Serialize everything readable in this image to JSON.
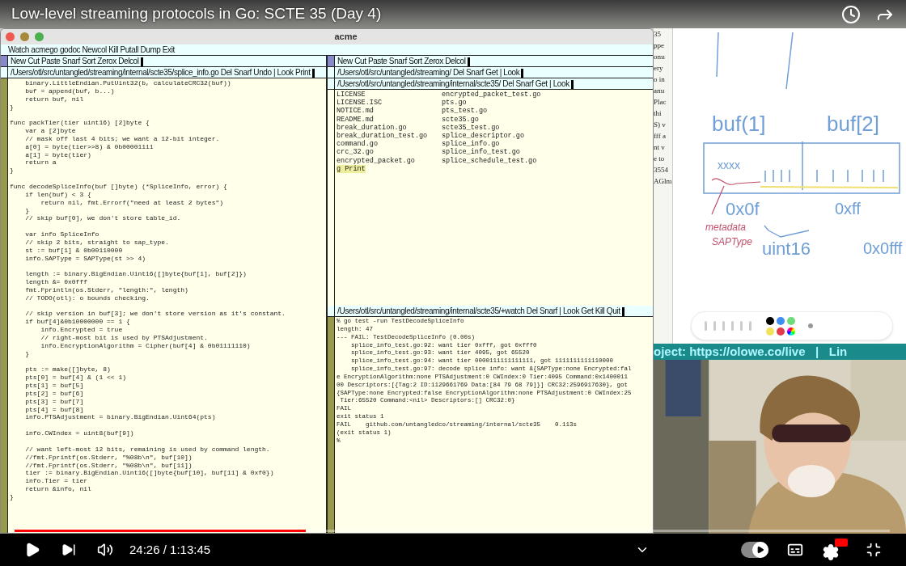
{
  "video": {
    "title": "Low-level streaming protocols in Go: SCTE 35 (Day 4)",
    "progress": {
      "level": 0.333
    },
    "time": "24:26 / 1:13:45",
    "autoplay": {
      "on": true
    }
  },
  "acme": {
    "title": "acme",
    "main_tag": "Watch acmego godoc Newcol Kill Putall Dump Exit",
    "columns": [
      {
        "tag": "New Cut Paste Snarf Sort Zerox Delcol",
        "windows": [
          {
            "tag": "/Users/otl/src/untangled/streaming/internal/scte35/splice_info.go Del Snarf Undo | Look Print",
            "kind": "text",
            "blocks": [
              [
                "    binary.LittleEndian.PutUint32(b, calculateCRC32(buf))",
                "    buf = append(buf, b...)",
                "    return buf, nil",
                "}"
              ],
              [
                "func packTier(tier uint16) [2]byte {",
                "    var a [2]byte",
                "    // mask off last 4 bits; we want a 12-bit integer.",
                "    a[0] = byte(tier>>8) & 0b00001111",
                "    a[1] = byte(tier)",
                "    return a",
                "}"
              ],
              [
                "func decodeSpliceInfo(buf []byte) (*SpliceInfo, error) {",
                "    if len(buf) < 3 {",
                "        return nil, fmt.Errorf(\"need at least 2 bytes\")",
                "    }",
                "    // skip buf[0], we don't store table_id."
              ],
              [
                "    var info SpliceInfo",
                "    // skip 2 bits, straight to sap_type.",
                "    st := buf[1] & 0b00110000",
                "    info.SAPType = SAPType(st >> 4)"
              ],
              [
                "    length := binary.BigEndian.Uint16([]byte{buf[1], buf[2]})",
                "    length &= 0x0fff",
                "    fmt.Fprintln(os.Stderr, \"length:\", length)",
                "    // TODO(otl): o bounds checking."
              ],
              [
                "    // skip version in buf[3]; we don't store version as it's constant.",
                "    if buf[4]&0b10000000 == 1 {",
                "        info.Encrypted = true",
                "        // right-most bit is used by PTSAdjustment.",
                "        info.EncryptionAlgorithm = Cipher(buf[4] & 0b01111110)",
                "    }"
              ],
              [
                "    pts := make([]byte, 8)",
                "    pts[0] = buf[4] & (1 << 1)",
                "    pts[1] = buf[5]",
                "    pts[2] = buf[6]",
                "    pts[3] = buf[7]",
                "    pts[4] = buf[8]",
                "    info.PTSAdjustment = binary.BigEndian.Uint64(pts)"
              ],
              [
                "    info.CWIndex = uint8(buf[9])"
              ],
              [
                "    // want left-most 12 bits, remaining is used by command length.",
                "    //fmt.Fprintf(os.Stderr, \"%08b\\n\", buf[10])",
                "    //fmt.Fprintf(os.Stderr, \"%08b\\n\", buf[11])",
                "    tier := binary.BigEndian.Uint16([]byte{buf[10], buf[11] & 0xf0})",
                "    info.Tier = tier",
                "    return &info, nil",
                "}"
              ]
            ]
          }
        ]
      },
      {
        "tag": "New Cut Paste Snarf Sort Zerox Delcol",
        "windows": [
          {
            "tag": "/Users/otl/src/untangled/streaming/ Del Snarf Get | Look",
            "kind": "collapsed"
          },
          {
            "tag": "/Users/otl/src/untangled/streaming/internal/scte35/ Del Snarf Get | Look",
            "kind": "directory",
            "file_columns": [
              [
                "LICENSE",
                "LICENSE.ISC",
                "NOTICE.md",
                "README.md",
                "break_duration.go",
                "break_duration_test.go",
                "command.go",
                "crc_32.go",
                "encrypted_packet.go"
              ],
              [
                "encrypted_packet_test.go",
                "pts.go",
                "pts_test.go",
                "scte35.go",
                "scte35_test.go",
                "splice_descriptor.go",
                "splice_info.go",
                "splice_info_test.go",
                "splice_schedule_test.go"
              ]
            ],
            "typed_line": {
              "text": "g Print",
              "selected": true
            }
          },
          {
            "tag": "/Users/otl/src/untangled/streaming/internal/scte35/+watch Del Snarf | Look Get Kill Quit",
            "kind": "text",
            "blocks": [
              [
                "% go test -run TestDecodeSpliceInfo",
                "length: 47",
                "--- FAIL: TestDecodeSpliceInfo (0.00s)",
                "    splice_info_test.go:92: want tier 0xfff, got 0xfff0",
                "    splice_info_test.go:93: want tier 4095, got 65520",
                "    splice_info_test.go:94: want tier 0000111111111111, got 1111111111110000",
                "    splice_info_test.go:97: decode splice info: want &{SAPType:none Encrypted:fal",
                "e EncryptionAlgorithm:none PTSAdjustment:0 CWIndex:0 Tier:4095 Command:0x1400011",
                "00 Descriptors:[{Tag:2 ID:1129661769 Data:[84 79 68 79]}] CRC32:2596917630}, got",
                "{SAPType:none Encrypted:false EncryptionAlgorithm:none PTSAdjustment:0 CWIndex:25",
                " Tier:65520 Command:<nil> Descriptors:[] CRC32:0}",
                "FAIL",
                "exit status 1",
                "FAIL    github.com/untangledco/streaming/internal/scte35    0.113s",
                "(exit status 1)",
                "%"
              ]
            ]
          }
        ]
      }
    ]
  },
  "background_document": {
    "fragments": [
      "35",
      "ppe",
      "omı",
      "ery",
      "o in",
      "amı",
      "Plac",
      "thi",
      "S) v",
      "fff a",
      "nt v",
      "e to",
      "3554",
      "AGlm"
    ]
  },
  "whiteboard": {
    "notes": [
      {
        "text": "buf(1]",
        "color": "#6f9fd6"
      },
      {
        "text": "buf[2]",
        "color": "#6f9fd6"
      },
      {
        "text": "xxxx",
        "color": "#6f9fd6"
      },
      {
        "text": "0x0f",
        "color": "#6f9fd6"
      },
      {
        "text": "0xff",
        "color": "#6f9fd6"
      },
      {
        "text": "metadata",
        "color": "#c0506a"
      },
      {
        "text": "SAPType",
        "color": "#c0506a"
      },
      {
        "text": "uint16",
        "color": "#6f9fd6"
      },
      {
        "text": "0x0fff",
        "color": "#6f9fd6"
      }
    ],
    "palette": [
      {
        "color": "#000000"
      },
      {
        "color": "#3f8ef0"
      },
      {
        "color": "#6edc7a"
      },
      {
        "color": "#f2e25a"
      },
      {
        "color": "#e23b4b"
      }
    ]
  },
  "webcam": {
    "banner": "oject: https://olowe.co/live   |   Lin"
  }
}
